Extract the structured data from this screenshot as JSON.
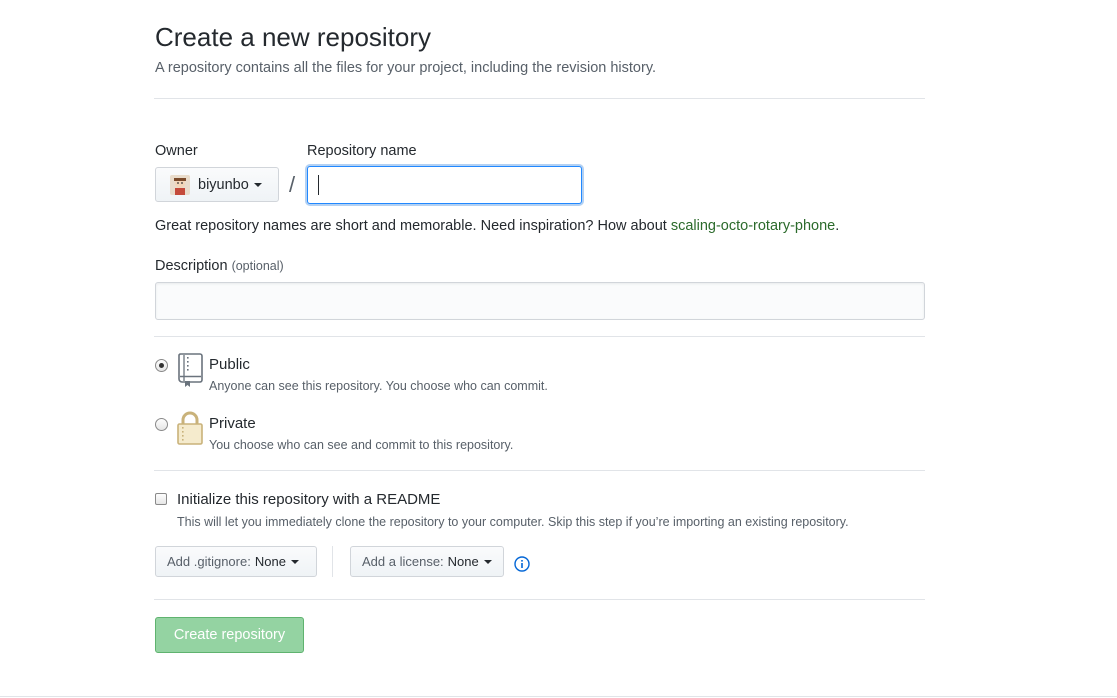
{
  "header": {
    "title": "Create a new repository",
    "subtitle": "A repository contains all the files for your project, including the revision history."
  },
  "owner": {
    "label": "Owner",
    "name": "biyunbo"
  },
  "repository": {
    "label": "Repository name",
    "separator": "/",
    "value": "",
    "hint_prefix": "Great repository names are short and memorable. Need inspiration? How about ",
    "hint_suggestion": "scaling-octo-rotary-phone",
    "hint_suffix": "."
  },
  "description": {
    "label": "Description",
    "optional": "(optional)",
    "value": ""
  },
  "visibility": {
    "selected": "public",
    "public": {
      "title": "Public",
      "note": "Anyone can see this repository. You choose who can commit."
    },
    "private": {
      "title": "Private",
      "note": "You choose who can see and commit to this repository."
    }
  },
  "readme": {
    "checked": false,
    "title": "Initialize this repository with a README",
    "note": "This will let you immediately clone the repository to your computer. Skip this step if you’re importing an existing repository."
  },
  "gitignore": {
    "prefix": "Add .gitignore:",
    "value": "None"
  },
  "license": {
    "prefix": "Add a license:",
    "value": "None"
  },
  "actions": {
    "create_label": "Create repository"
  },
  "colors": {
    "accent_blue": "#2188ff",
    "suggestion_green": "#2b6a2b",
    "create_button_disabled": "#94d3a2",
    "lock_gold": "#c9b27a"
  },
  "icons": {
    "public": "repo-book-icon",
    "private": "lock-icon",
    "info": "info-icon",
    "avatar": "avatar"
  }
}
